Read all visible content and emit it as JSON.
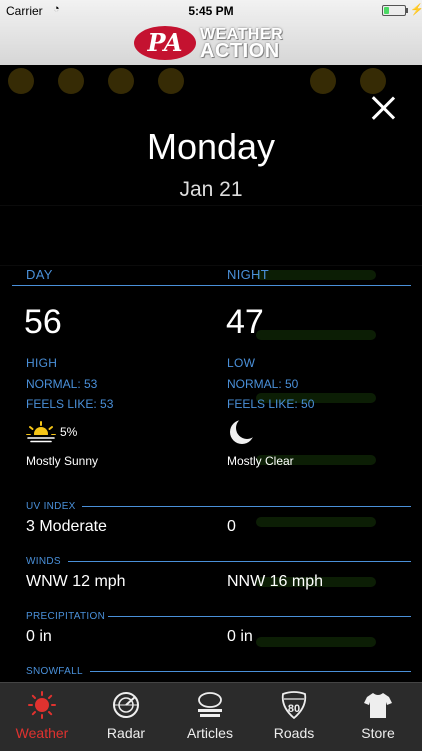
{
  "status_bar": {
    "carrier": "Carrier",
    "time": "5:45 PM",
    "battery_level": 0.25
  },
  "header": {
    "logo_badge": "PA",
    "logo_word1": "WEATHER",
    "logo_word2": "ACTION"
  },
  "detail": {
    "day": "Monday",
    "date": "Jan 21",
    "day_col": {
      "heading": "DAY",
      "temp": "56",
      "type_label": "HIGH",
      "normal": "NORMAL: 53",
      "feels_like": "FEELS LIKE: 53",
      "precip_chance": "5%",
      "condition": "Mostly Sunny",
      "icon": "mostly-sunny-icon"
    },
    "night_col": {
      "heading": "NIGHT",
      "temp": "47",
      "type_label": "LOW",
      "normal": "NORMAL: 50",
      "feels_like": "FEELS LIKE: 50",
      "condition": "Mostly Clear",
      "icon": "moon-icon"
    },
    "uv": {
      "label": "UV INDEX",
      "day": "3 Moderate",
      "night": "0"
    },
    "winds": {
      "label": "WINDS",
      "day": "WNW 12 mph",
      "night": "NNW 16 mph"
    },
    "precipitation": {
      "label": "PRECIPITATION",
      "day": "0 in",
      "night": "0 in"
    },
    "snowfall": {
      "label": "SNOWFALL"
    }
  },
  "tabs": [
    {
      "label": "Weather",
      "icon": "sun-icon",
      "active": true
    },
    {
      "label": "Radar",
      "icon": "radar-icon",
      "active": false
    },
    {
      "label": "Articles",
      "icon": "articles-logo-icon",
      "active": false
    },
    {
      "label": "Roads",
      "icon": "interstate-80-icon",
      "shield_text": "80",
      "active": false
    },
    {
      "label": "Store",
      "icon": "shirt-icon",
      "active": false
    }
  ],
  "colors": {
    "accent": "#4a90d9",
    "active_tab": "#e0322f",
    "brand_red": "#c41230"
  }
}
